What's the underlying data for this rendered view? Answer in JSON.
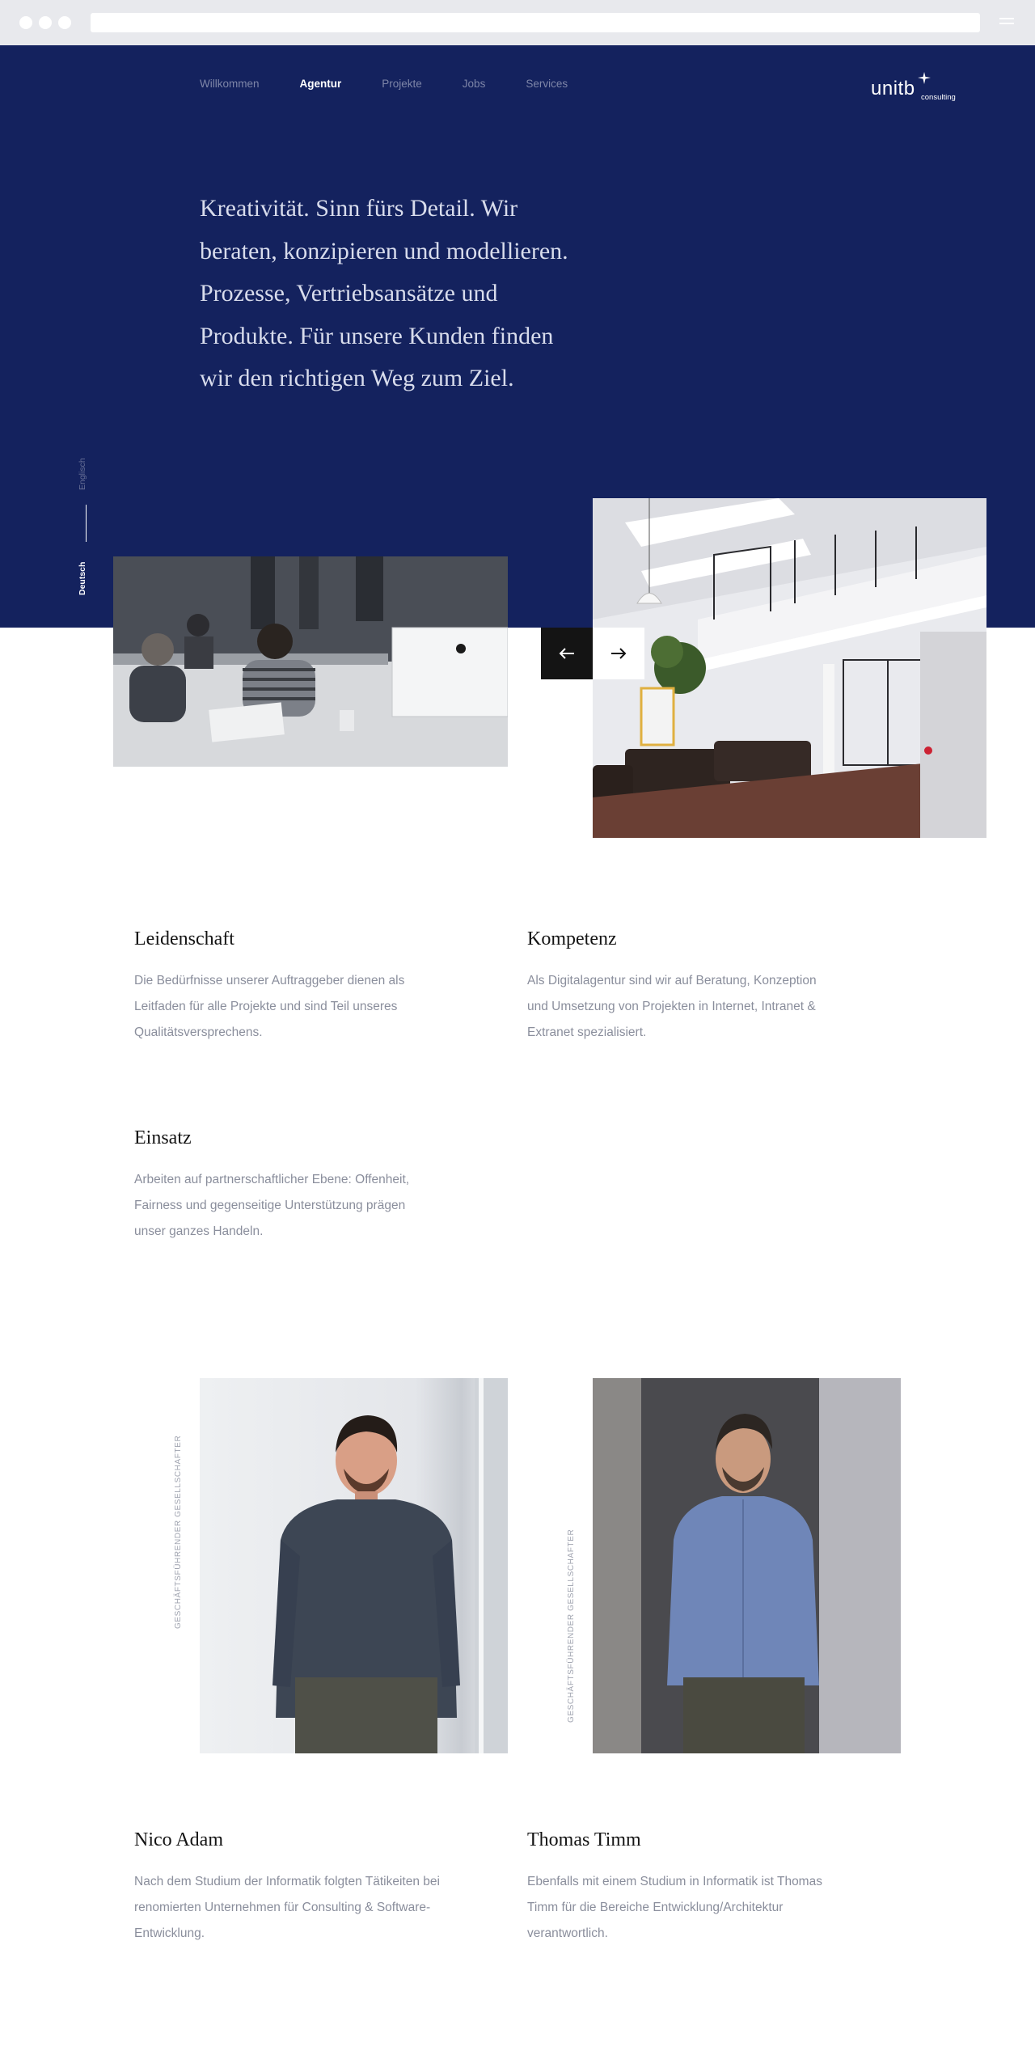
{
  "nav": {
    "items": [
      {
        "label": "Willkommen"
      },
      {
        "label": "Agentur"
      },
      {
        "label": "Projekte"
      },
      {
        "label": "Jobs"
      },
      {
        "label": "Services"
      }
    ],
    "active": "Agentur"
  },
  "logo": {
    "word": "unitb",
    "sub": "consulting"
  },
  "hero": {
    "text": "Kreativität. Sinn fürs Detail. Wir beraten, konzipieren und modellieren. Prozesse, Vertriebsansätze und Produkte. Für unsere Kunden finden wir den richtigen Weg zum Ziel."
  },
  "language": {
    "other": "Englisch",
    "current": "Deutsch"
  },
  "slider": {
    "prev_icon": "arrow-left-icon",
    "next_icon": "arrow-right-icon"
  },
  "values": [
    {
      "title": "Leidenschaft",
      "text": "Die Bedürfnisse unserer Auftraggeber dienen als Leitfaden für alle Projekte und sind Teil unseres Qualitätsversprechens."
    },
    {
      "title": "Kompetenz",
      "text": "Als Digitalagentur sind wir auf Beratung, Konzeption und Umsetzung von Projekten in Internet, Intranet & Extranet spezialisiert."
    },
    {
      "title": "Einsatz",
      "text": "Arbeiten auf partnerschaftlicher Ebene: Offenheit, Fairness und gegenseitige Unterstützung prägen unser ganzes Handeln."
    }
  ],
  "team": [
    {
      "role": "GESCHÄFTSFÜHRENDER GESELLSCHAFTER",
      "name": "Nico Adam",
      "text": "Nach dem Studium der Informatik folgten Tätikeiten bei renomierten Unternehmen für Consulting & Software-Entwicklung."
    },
    {
      "role": "GESCHÄFTSFÜHRENDER GESELLSCHAFTER",
      "name": "Thomas Timm",
      "text": "Ebenfalls mit einem Studium in Informatik ist Thomas Timm für die Bereiche Entwicklung/Architektur verantwortlich."
    }
  ],
  "colors": {
    "hero_bg": "#14225e",
    "text_muted": "#8a8e9c",
    "heading": "#141414"
  }
}
